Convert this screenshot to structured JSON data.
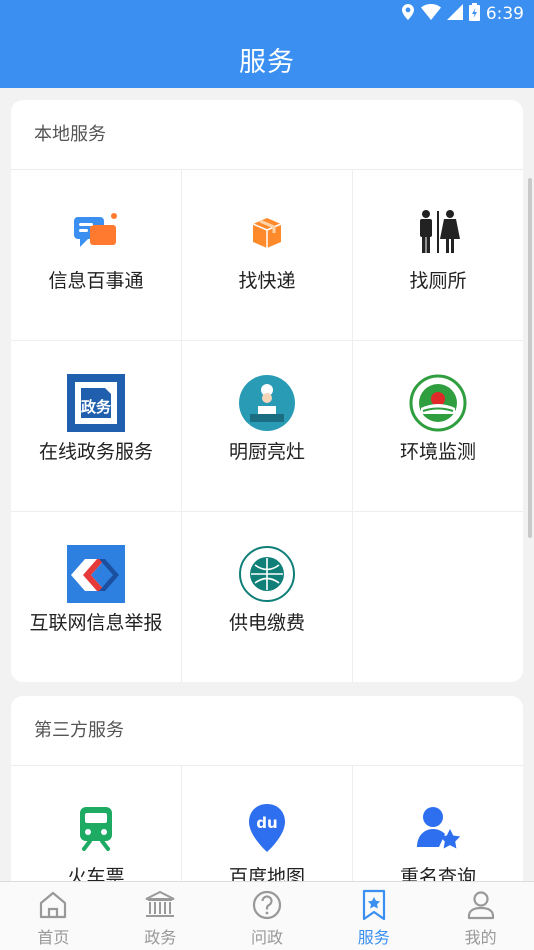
{
  "status": {
    "time": "6:39"
  },
  "header": {
    "title": "服务"
  },
  "local_services": {
    "title": "本地服务",
    "items": [
      {
        "label": "信息百事通",
        "icon": "chat-bubbles-icon"
      },
      {
        "label": "找快递",
        "icon": "package-box-icon"
      },
      {
        "label": "找厕所",
        "icon": "restroom-icon"
      },
      {
        "label": "在线政务服务",
        "icon": "gov-affairs-icon"
      },
      {
        "label": "明厨亮灶",
        "icon": "chef-kitchen-icon"
      },
      {
        "label": "环境监测",
        "icon": "environment-monitor-icon"
      },
      {
        "label": "互联网信息举报",
        "icon": "internet-report-icon"
      },
      {
        "label": "供电缴费",
        "icon": "state-grid-icon"
      }
    ]
  },
  "third_party": {
    "title": "第三方服务",
    "items": [
      {
        "label": "火车票",
        "icon": "train-icon"
      },
      {
        "label": "百度地图",
        "icon": "baidu-map-icon"
      },
      {
        "label": "重名查询",
        "icon": "user-star-icon"
      }
    ]
  },
  "tabbar": {
    "items": [
      {
        "label": "首页",
        "icon": "home-icon"
      },
      {
        "label": "政务",
        "icon": "government-building-icon"
      },
      {
        "label": "问政",
        "icon": "question-icon"
      },
      {
        "label": "服务",
        "icon": "bookmark-star-icon",
        "active": true
      },
      {
        "label": "我的",
        "icon": "person-icon"
      }
    ]
  },
  "colors": {
    "primary": "#3a8ff0",
    "background": "#f2f2f2"
  }
}
